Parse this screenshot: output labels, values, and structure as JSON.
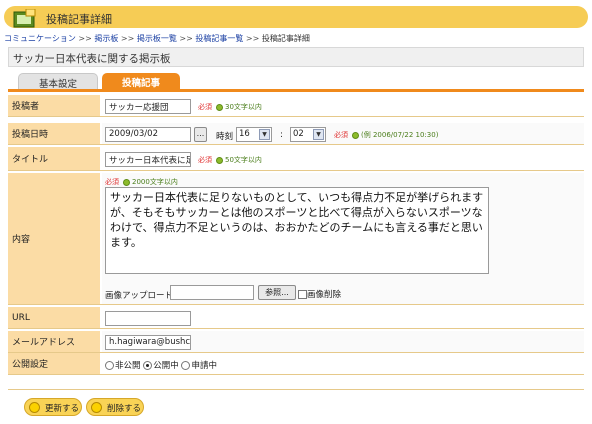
{
  "header": {
    "title": "投稿記事詳細"
  },
  "breadcrumb": {
    "items": [
      "コミュニケーション",
      "掲示板",
      "掲示板一覧",
      "投稿記事一覧"
    ],
    "separator": ">>",
    "current": "投稿記事詳細"
  },
  "board": {
    "title": "サッカー日本代表に関する掲示板"
  },
  "tabs": {
    "basic": "基本設定",
    "post": "投稿記事"
  },
  "form": {
    "required": "必須",
    "poster": {
      "label": "投稿者",
      "value": "サッカー応援団",
      "hint": "30文字以内"
    },
    "date": {
      "label": "投稿日時",
      "value": "2009/03/02",
      "picker": "...",
      "time_label": "時刻",
      "hour": "16",
      "colon": ":",
      "minute": "02",
      "hint": "(例 2006/07/22 10:30)"
    },
    "title": {
      "label": "タイトル",
      "value": "サッカー日本代表に足",
      "hint": "50文字以内"
    },
    "content": {
      "label": "内容",
      "hint": "2000文字以内",
      "value": "サッカー日本代表に足りないものとして、いつも得点力不足が挙げられますが、そもそもサッカーとは他のスポーツと比べて得点が入らないスポーツなわけで、得点力不足というのは、おおかたどのチームにも言える事だと思います。",
      "upload_label": "画像アップロード",
      "browse": "参照...",
      "delete_image": "画像削除"
    },
    "url": {
      "label": "URL",
      "value": ""
    },
    "email": {
      "label": "メールアドレス",
      "value": "h.hagiwara@bushclo"
    },
    "visibility": {
      "label": "公開設定",
      "options": [
        "非公開",
        "公開中",
        "申請中"
      ],
      "selected": "公開中"
    }
  },
  "actions": {
    "update": "更新する",
    "delete": "削除する"
  },
  "colors": {
    "accent": "#f08a1c",
    "label_bg": "#fbdca5",
    "header": "#f6cc55",
    "link": "#1a3fa3",
    "required": "#e03030"
  }
}
